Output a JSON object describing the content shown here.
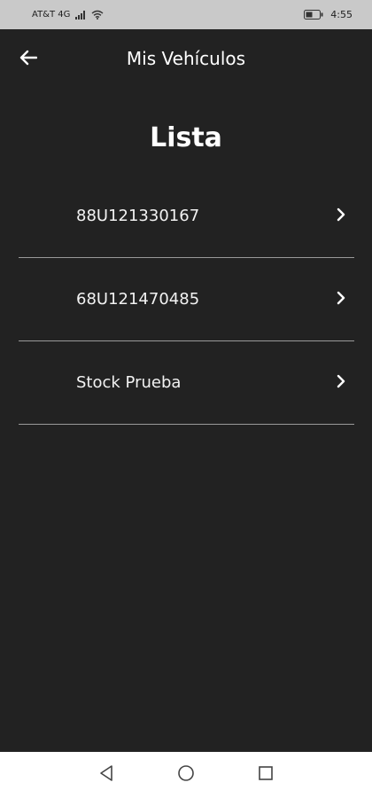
{
  "status_bar": {
    "carrier": "AT&T 4G",
    "time": "4:55",
    "icons": [
      "signal-icon",
      "wifi-icon",
      "battery-icon"
    ]
  },
  "app_bar": {
    "back_icon": "arrow-left-icon",
    "title": "Mis Vehículos"
  },
  "heading": "Lista",
  "vehicles": [
    {
      "label": "88U121330167",
      "icon": "chevron-right-icon"
    },
    {
      "label": "68U121470485",
      "icon": "chevron-right-icon"
    },
    {
      "label": "Stock Prueba",
      "icon": "chevron-right-icon"
    }
  ],
  "nav_bar": {
    "icons": [
      "back-triangle-icon",
      "home-circle-icon",
      "recents-square-icon"
    ]
  },
  "colors": {
    "background": "#222222",
    "status_bar": "#c9c9c9",
    "divider": "#9a9a9a",
    "nav_bar": "#ffffff"
  }
}
